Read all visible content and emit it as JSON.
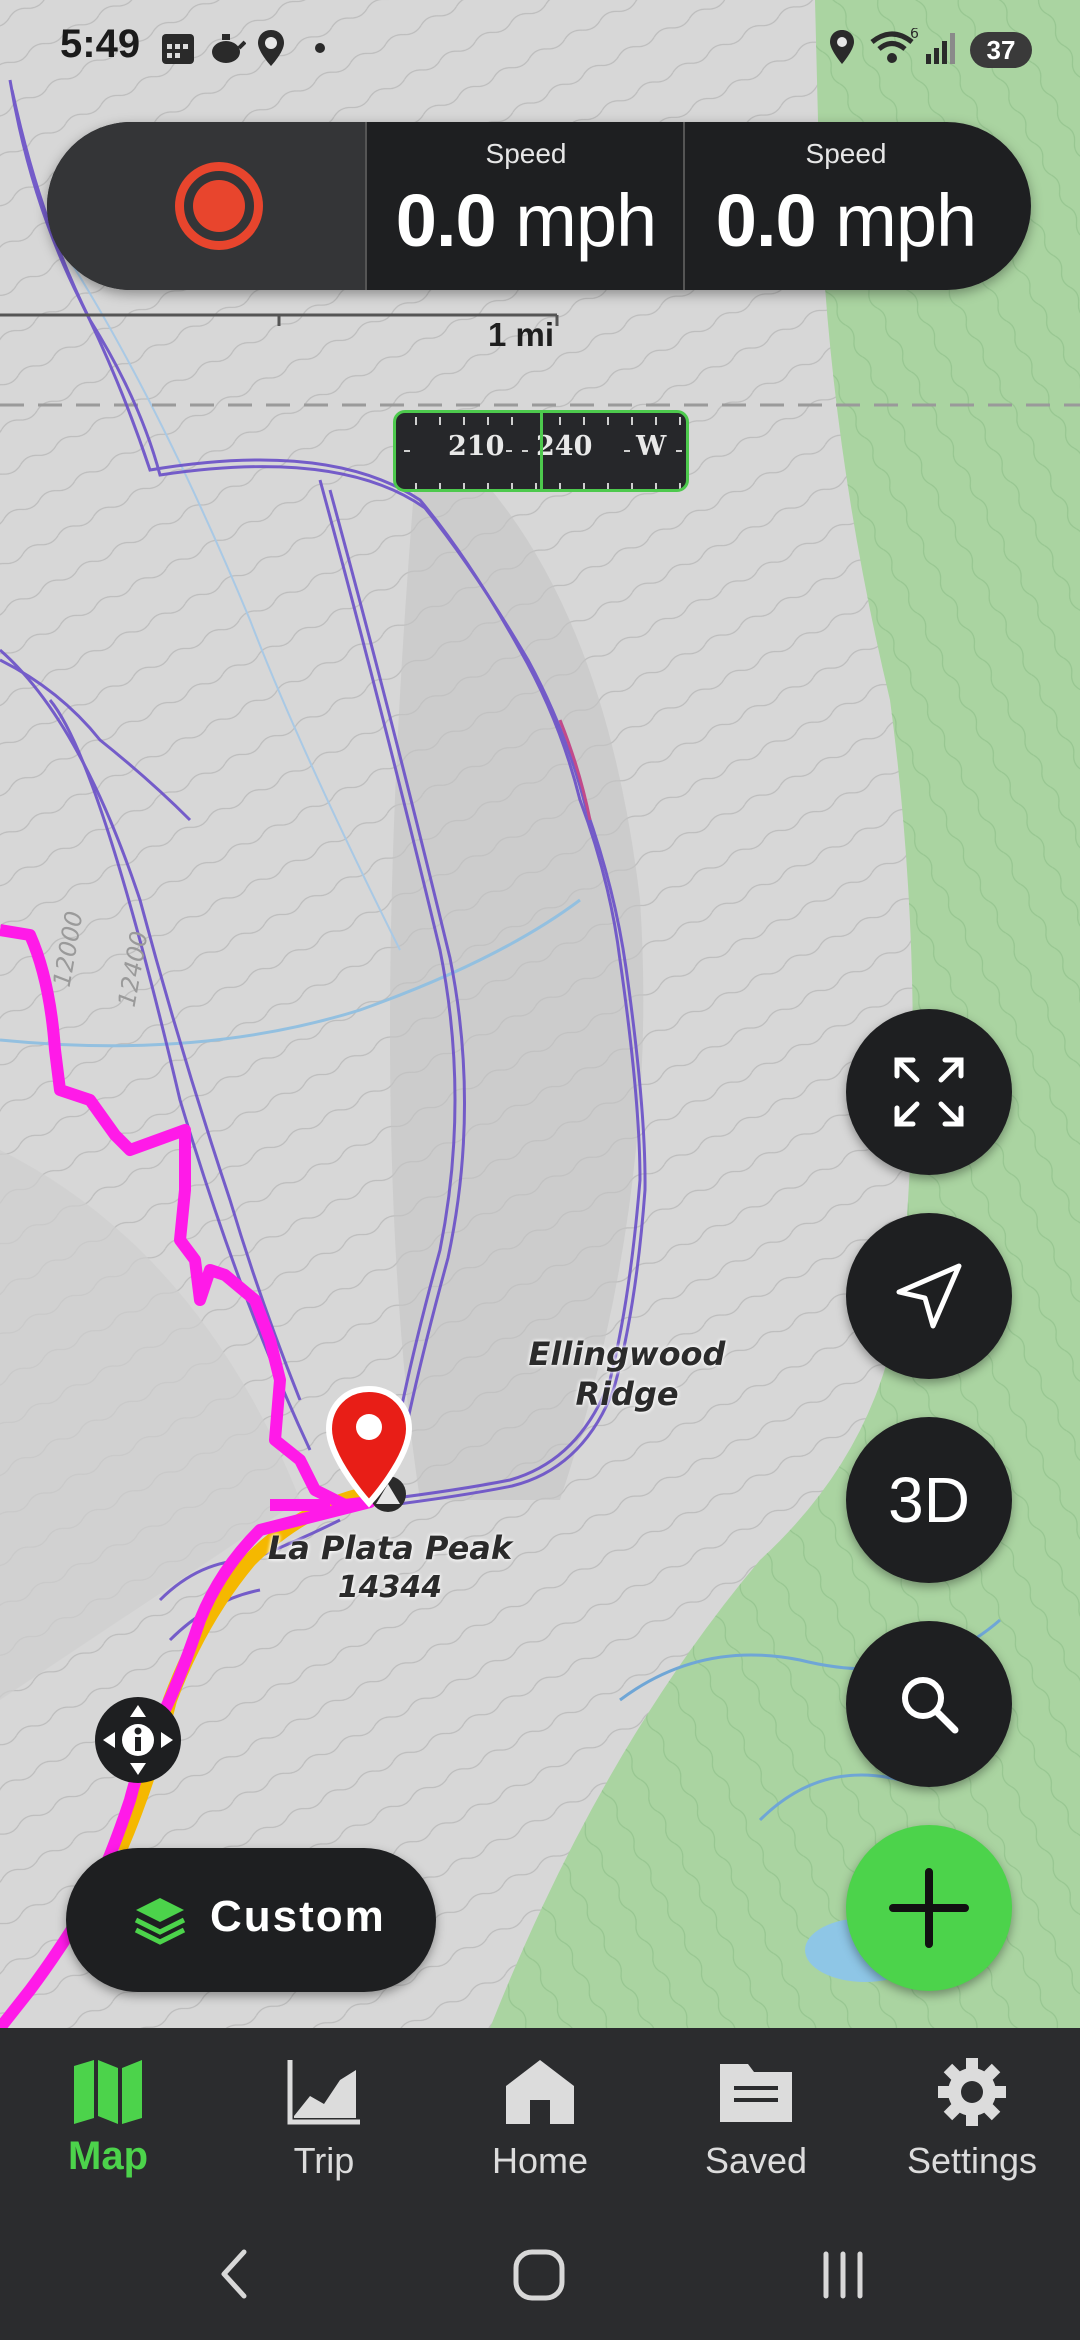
{
  "status_bar": {
    "time": "5:49",
    "battery": "37",
    "left_icons": [
      "calendar-icon",
      "teapot-icon",
      "location-pin-icon",
      "dot-icon"
    ],
    "right_icons": [
      "location-icon",
      "wifi-icon",
      "signal-icon",
      "battery-icon"
    ]
  },
  "speed_bar": {
    "record_icon": "record-icon",
    "cells": [
      {
        "label": "Speed",
        "value": "0.0",
        "unit": "mph"
      },
      {
        "label": "Speed",
        "value": "0.0",
        "unit": "mph"
      }
    ]
  },
  "scale": {
    "label": "1 mi"
  },
  "compass": {
    "ticks": [
      "210",
      "240",
      "W"
    ]
  },
  "map_labels": {
    "ridge_line1": "Ellingwood",
    "ridge_line2": "Ridge",
    "peak_name": "La Plata Peak",
    "peak_elevation": "14344",
    "contour_1": "12000",
    "contour_2": "12400"
  },
  "fab": {
    "fullscreen_icon": "fullscreen-icon",
    "navigate_icon": "navigate-arrow-icon",
    "three_d_label": "3D",
    "search_icon": "search-icon",
    "add_icon": "plus-icon"
  },
  "layer_button": {
    "label": "Custom",
    "icon": "layers-icon"
  },
  "bottom_nav": {
    "items": [
      {
        "label": "Map",
        "icon": "map-icon",
        "active": true
      },
      {
        "label": "Trip",
        "icon": "chart-icon",
        "active": false
      },
      {
        "label": "Home",
        "icon": "home-icon",
        "active": false
      },
      {
        "label": "Saved",
        "icon": "folder-icon",
        "active": false
      },
      {
        "label": "Settings",
        "icon": "gear-icon",
        "active": false
      }
    ]
  },
  "colors": {
    "accent_green": "#4cd34b",
    "record_red": "#e8452d",
    "route_magenta": "#ff1ae8",
    "route_yellow": "#f5b800",
    "track_purple": "#6a4fc8",
    "forest_green": "#a9d4a0",
    "marker_red": "#e81e17"
  }
}
